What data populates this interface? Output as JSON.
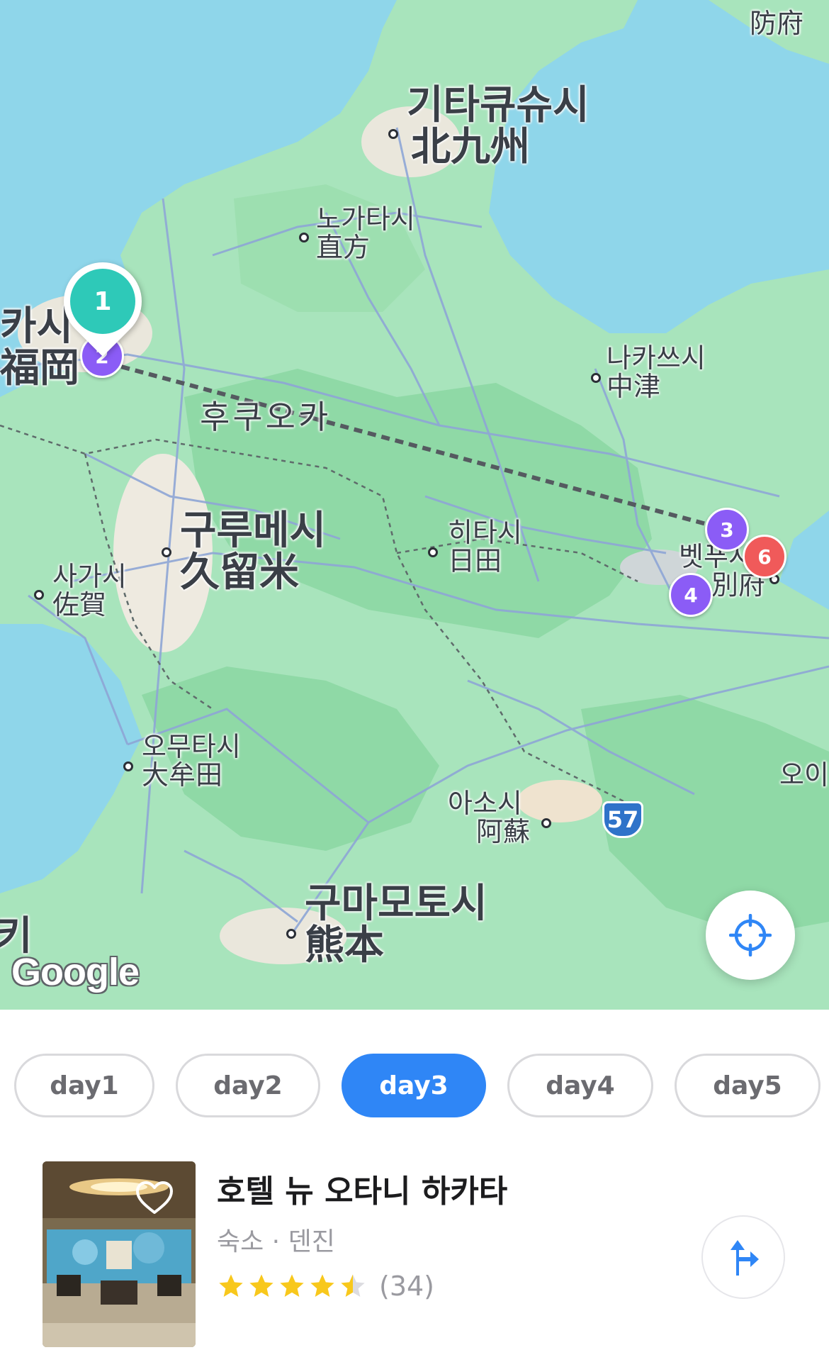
{
  "map": {
    "google_logo": "Google",
    "cities": [
      {
        "id": "kitakyushu",
        "ko": "기타큐슈시",
        "ja": "北九州",
        "size": "large"
      },
      {
        "id": "nogata",
        "ko": "노가타시",
        "ja": "直方",
        "size": "small"
      },
      {
        "id": "fukuoka-city",
        "ko": "카시",
        "ja": "福岡",
        "size": "large"
      },
      {
        "id": "nakatsu",
        "ko": "나카쓰시",
        "ja": "中津",
        "size": "small"
      },
      {
        "id": "fukuoka-pref",
        "ko": "후쿠오카",
        "ja": "",
        "size": "region"
      },
      {
        "id": "kurume",
        "ko": "구루메시",
        "ja": "久留米",
        "size": "large"
      },
      {
        "id": "hita",
        "ko": "히타시",
        "ja": "日田",
        "size": "small"
      },
      {
        "id": "saga",
        "ko": "사가시",
        "ja": "佐賀",
        "size": "small"
      },
      {
        "id": "beppu",
        "ko": "벳푸시",
        "ja": "別府",
        "size": "small"
      },
      {
        "id": "omuta",
        "ko": "오무타시",
        "ja": "大牟田",
        "size": "small"
      },
      {
        "id": "aso",
        "ko": "아소시",
        "ja": "阿蘇",
        "size": "small"
      },
      {
        "id": "kumamoto",
        "ko": "구마모토시",
        "ja": "熊本",
        "size": "large"
      },
      {
        "id": "hofu",
        "ko": "",
        "ja": "防府",
        "size": "small"
      },
      {
        "id": "oita-edge",
        "ko": "오이",
        "ja": "",
        "size": "small"
      },
      {
        "id": "left-edge",
        "ko": "키",
        "ja": "",
        "size": "small"
      }
    ],
    "route_badge": "57",
    "markers": [
      {
        "label": "1",
        "color": "#2ec9b8",
        "selected": true
      },
      {
        "label": "2",
        "color": "#8b5cf6"
      },
      {
        "label": "3",
        "color": "#8b5cf6"
      },
      {
        "label": "4",
        "color": "#8b5cf6"
      },
      {
        "label": "6",
        "color": "#f05a5a"
      }
    ],
    "locate_button_icon": "crosshair-icon"
  },
  "tabs": {
    "items": [
      {
        "label": "day1",
        "active": false
      },
      {
        "label": "day2",
        "active": false
      },
      {
        "label": "day3",
        "active": true
      },
      {
        "label": "day4",
        "active": false
      },
      {
        "label": "day5",
        "active": false
      }
    ],
    "active_color": "#2f86f6"
  },
  "place": {
    "name": "호텔 뉴 오타니 하카타",
    "category": "숙소",
    "separator": "·",
    "area": "덴진",
    "meta": "숙소 · 덴진",
    "rating": 4.5,
    "review_count": "(34)",
    "favorite_icon": "heart-outline-icon",
    "directions_icon": "directions-icon"
  }
}
